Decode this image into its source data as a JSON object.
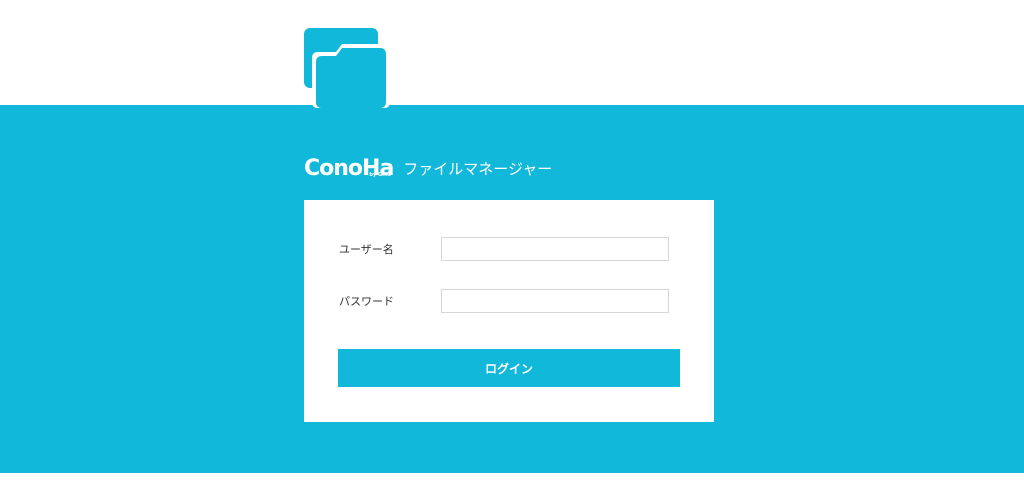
{
  "header": {
    "app_icon": "folder-icon"
  },
  "brand": {
    "logo_text": "ConoHa",
    "logo_sub": "by GMO",
    "title": "ファイルマネージャー"
  },
  "login_form": {
    "username_label": "ユーザー名",
    "username_value": "",
    "username_placeholder": "",
    "password_label": "パスワード",
    "password_value": "",
    "password_placeholder": "",
    "login_label": "ログイン"
  },
  "colors": {
    "accent": "#12b8d9",
    "panel": "#ffffff",
    "page_background": "#ffffff",
    "input_border": "#d6d6d6",
    "label_text": "#333333"
  }
}
